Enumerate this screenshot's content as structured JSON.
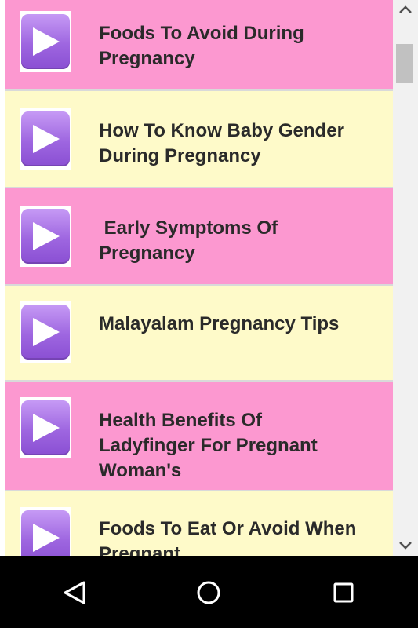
{
  "items": [
    {
      "title_line1": "Foods To Avoid During",
      "title_line2": "Pregnancy",
      "title_line3": ""
    },
    {
      "title_line1": "How To Know Baby Gender",
      "title_line2": "During Pregnancy",
      "title_line3": ""
    },
    {
      "title_line1": " Early Symptoms Of",
      "title_line2": "Pregnancy",
      "title_line3": ""
    },
    {
      "title_line1": "Malayalam Pregnancy Tips",
      "title_line2": "",
      "title_line3": ""
    },
    {
      "title_line1": "Health Benefits Of",
      "title_line2": "Ladyfinger For Pregnant",
      "title_line3": "Woman's"
    },
    {
      "title_line1": "Foods To Eat Or Avoid When",
      "title_line2": "Pregnant",
      "title_line3": ""
    }
  ],
  "item_icon": "play-video-icon",
  "colors": {
    "pink_row": "#fc98d0",
    "yellow_row": "#fefac9",
    "play_button": "#9e66e0",
    "nav_bar": "#000000"
  },
  "nav": {
    "back_icon": "back-triangle-icon",
    "home_icon": "home-circle-icon",
    "recents_icon": "recents-square-icon"
  }
}
